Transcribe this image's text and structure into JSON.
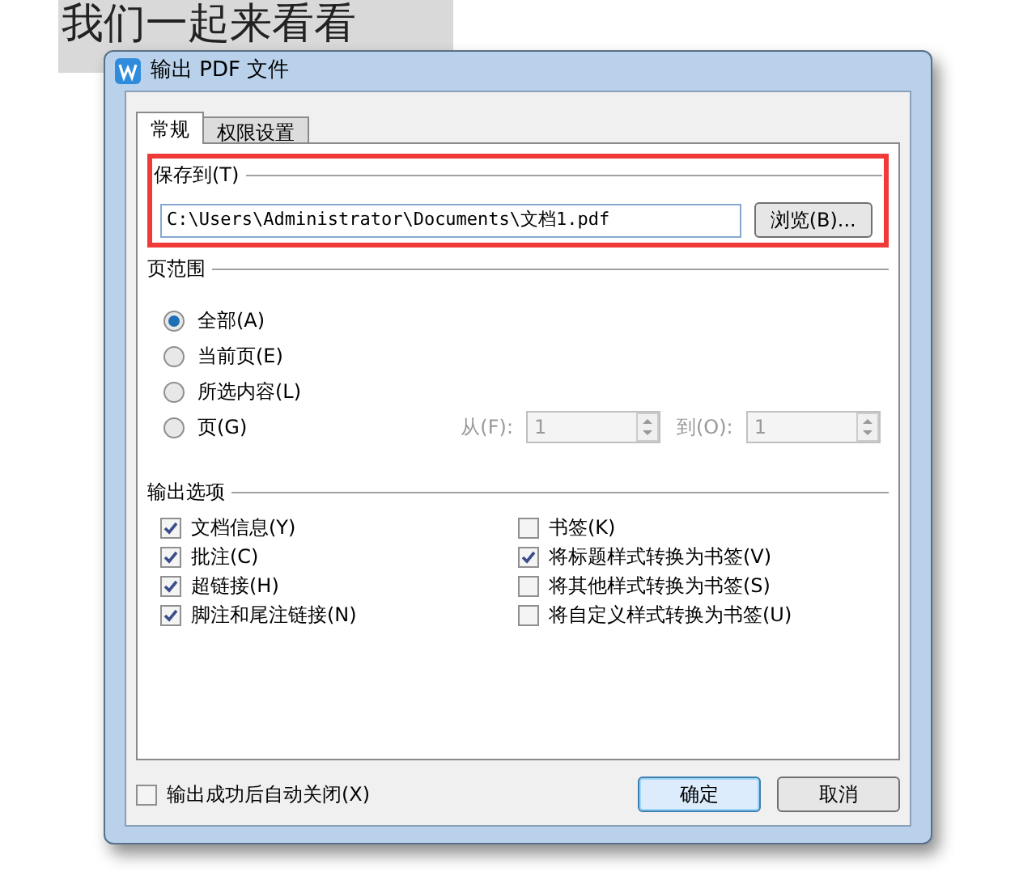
{
  "background_text": "我们一起来看看",
  "window": {
    "title": "输出 PDF 文件"
  },
  "tabs": [
    {
      "label": "常规",
      "selected": true
    },
    {
      "label": "权限设置",
      "selected": false
    }
  ],
  "save_to": {
    "heading": "保存到(T)",
    "value": "C:\\Users\\Administrator\\Documents\\文档1.pdf",
    "highlighted": true,
    "browse_button": "浏览(B)..."
  },
  "page_range": {
    "heading": "页范围",
    "options": [
      {
        "label": "全部(A)",
        "selected": true
      },
      {
        "label": "当前页(E)",
        "selected": false
      },
      {
        "label": "所选内容(L)",
        "selected": false
      },
      {
        "label": "页(G)",
        "selected": false
      }
    ],
    "from_label": "从(F):",
    "from_value": "1",
    "to_label": "到(O):",
    "to_value": "1",
    "disabled": true
  },
  "output_options": {
    "heading": "输出选项",
    "left": [
      {
        "label": "文档信息(Y)",
        "checked": true
      },
      {
        "label": "批注(C)",
        "checked": true
      },
      {
        "label": "超链接(H)",
        "checked": true
      },
      {
        "label": "脚注和尾注链接(N)",
        "checked": true
      }
    ],
    "right": [
      {
        "label": "书签(K)",
        "checked": false
      },
      {
        "label": "将标题样式转换为书签(V)",
        "checked": true
      },
      {
        "label": "将其他样式转换为书签(S)",
        "checked": false
      },
      {
        "label": "将自定义样式转换为书签(U)",
        "checked": false
      }
    ]
  },
  "auto_close": {
    "label": "输出成功后自动关闭(X)",
    "checked": false
  },
  "buttons": [
    {
      "label": "确定",
      "default": true
    },
    {
      "label": "取消",
      "default": false
    }
  ]
}
